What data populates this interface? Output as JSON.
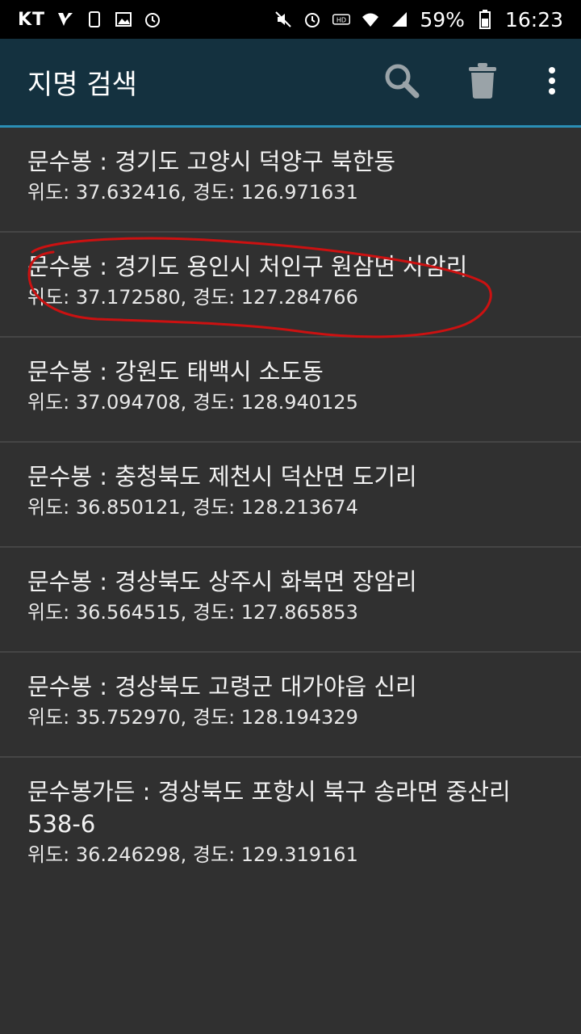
{
  "status_bar": {
    "carrier": "KT",
    "battery": "59%",
    "time": "16:23",
    "icons_left": [
      "signal-v-icon",
      "phone-icon",
      "image-icon",
      "alarm-icon"
    ],
    "icons_right": [
      "mute-icon",
      "alarm-icon",
      "hd-icon",
      "wifi-icon",
      "cell-signal-icon",
      "battery-icon"
    ]
  },
  "app_bar": {
    "title": "지명 검색",
    "actions": [
      "search-icon",
      "trash-icon",
      "overflow-menu-icon"
    ],
    "color": "#14313f",
    "accent": "#2a8fb6"
  },
  "results": [
    {
      "title": "문수봉 : 경기도 고양시 덕양구 북한동",
      "coords": "위도: 37.632416, 경도: 126.971631"
    },
    {
      "title": "문수봉 : 경기도 용인시 처인구 원삼면 사암리",
      "coords": "위도: 37.172580, 경도: 127.284766"
    },
    {
      "title": "문수봉 : 강원도 태백시 소도동",
      "coords": "위도: 37.094708, 경도: 128.940125"
    },
    {
      "title": "문수봉 : 충청북도 제천시 덕산면 도기리",
      "coords": "위도: 36.850121, 경도: 128.213674"
    },
    {
      "title": "문수봉 : 경상북도 상주시 화북면 장암리",
      "coords": "위도: 36.564515, 경도: 127.865853"
    },
    {
      "title": "문수봉 : 경상북도 고령군 대가야읍 신리",
      "coords": "위도: 35.752970, 경도: 128.194329"
    },
    {
      "title": "문수봉가든 : 경상북도 포항시 북구 송라면 중산리 538-6",
      "coords": "위도: 36.246298, 경도: 129.319161"
    }
  ],
  "annotation_color": "#cc1111"
}
